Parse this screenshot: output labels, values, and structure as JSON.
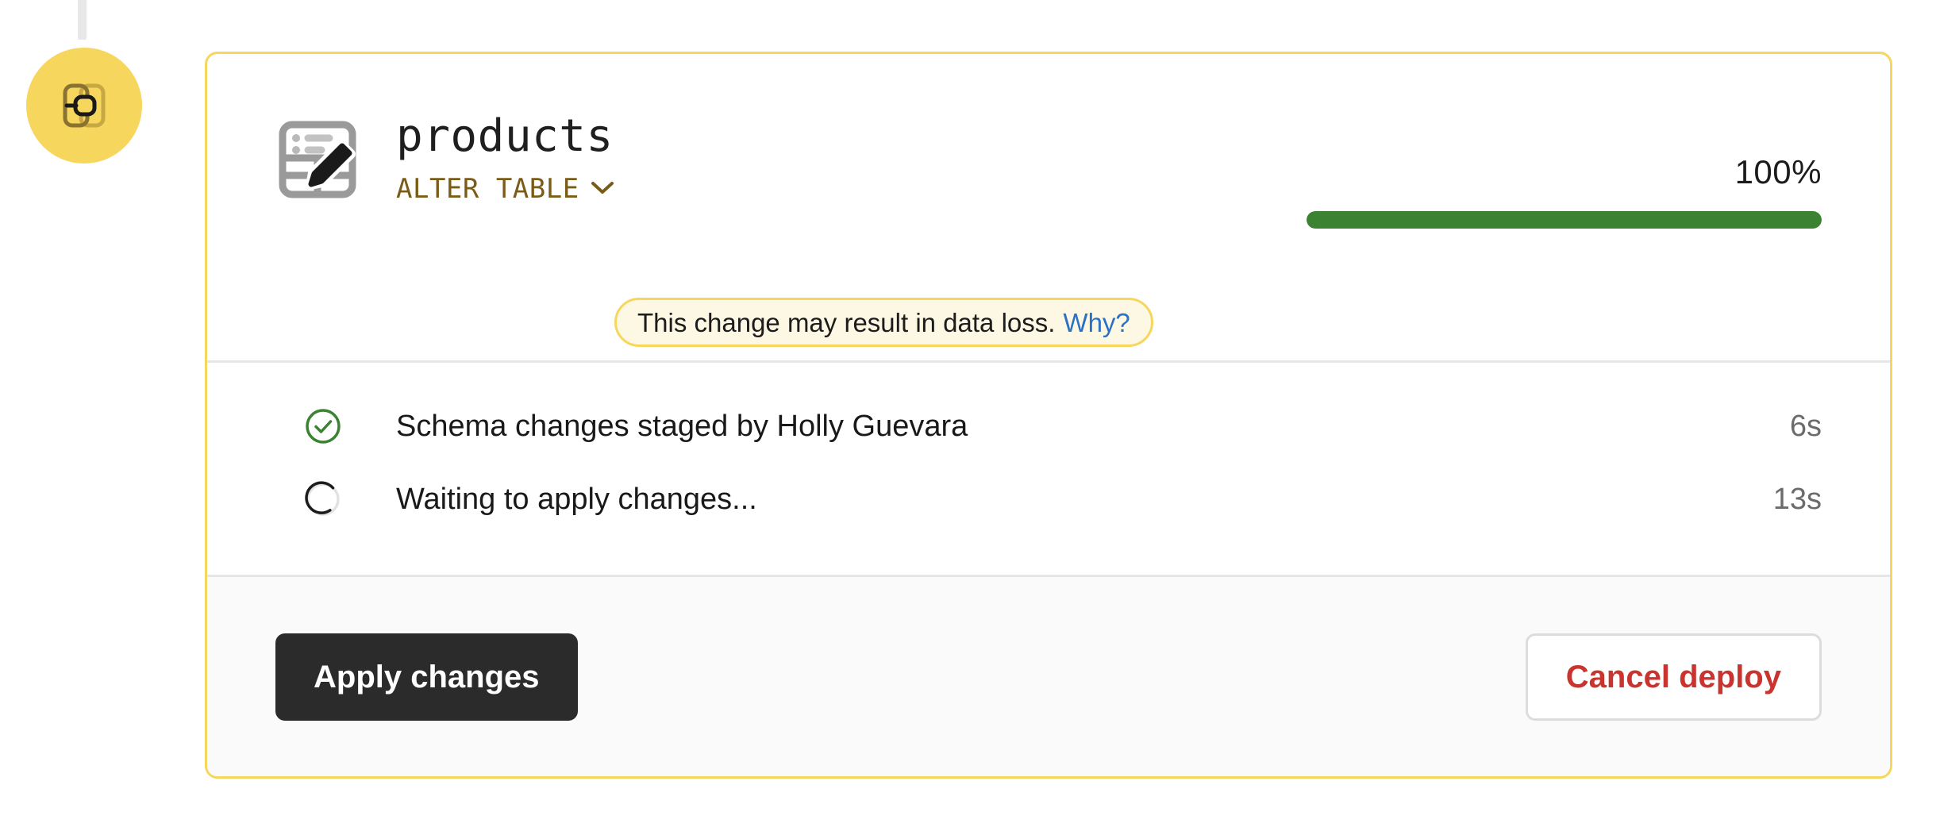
{
  "timeline": {
    "connector_present": true,
    "avatar_icon": "schema-diff-icon",
    "avatar_color": "#f7d65d"
  },
  "card": {
    "border_color": "#f7d65d",
    "header": {
      "object_icon": "table-edit-icon",
      "object_name": "products",
      "operation": "ALTER TABLE",
      "operation_color": "#7a5c18",
      "operation_chevron": "chevron-down-icon",
      "warning": {
        "message": "This change may result in data loss.",
        "link_label": "Why?",
        "link_color": "#2a72c8",
        "background": "#fdf8e3",
        "border_color": "#f7d65d"
      },
      "progress": {
        "percent_label": "100%",
        "percent_value": 100,
        "fill_color": "#3c8233",
        "track_color": "#e7e7e7"
      }
    },
    "steps": [
      {
        "icon": "check-circle-icon",
        "status": "complete",
        "label": "Schema changes staged by Holly Guevara",
        "duration": "6s"
      },
      {
        "icon": "spinner-icon",
        "status": "in-progress",
        "label": "Waiting to apply changes...",
        "duration": "13s"
      }
    ],
    "footer": {
      "apply_label": "Apply changes",
      "cancel_label": "Cancel deploy",
      "apply_bg": "#2b2b2b",
      "cancel_color": "#c9342f",
      "background": "#fafafa"
    }
  }
}
